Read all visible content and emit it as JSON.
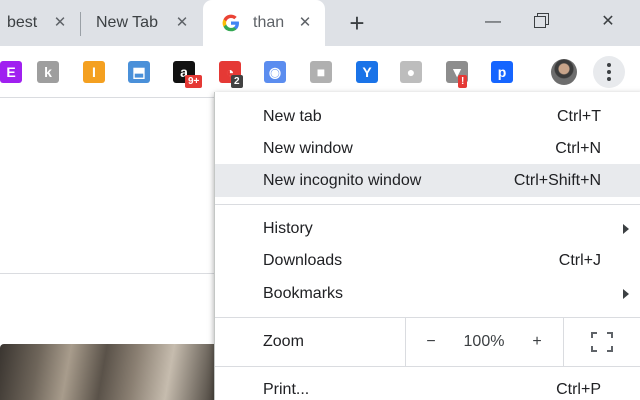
{
  "tabs": [
    {
      "title": "best",
      "close": "✕"
    },
    {
      "title": "New Tab",
      "close": "✕"
    },
    {
      "title": "than",
      "close": "✕"
    }
  ],
  "new_tab_symbol": "+",
  "window_controls": {
    "minimize": "—",
    "close": "✕"
  },
  "extensions": [
    {
      "icon": "purple-e-extension-icon",
      "glyph": "E",
      "color": "#a020f0"
    },
    {
      "icon": "grey-k-extension-icon",
      "glyph": "k",
      "color": "#9e9e9e"
    },
    {
      "icon": "orange-bar-extension-icon",
      "glyph": "I",
      "color": "#f4a020"
    },
    {
      "icon": "image-extension-icon",
      "glyph": "⬒",
      "color": "#4a90d9"
    },
    {
      "icon": "amazon-extension-icon",
      "glyph": "a",
      "color": "#111111",
      "badge": "9+"
    },
    {
      "icon": "red-circle-extension-icon",
      "glyph": "◔",
      "color": "#e53935",
      "badge": "2"
    },
    {
      "icon": "camera-extension-icon",
      "glyph": "◉",
      "color": "#5b8def"
    },
    {
      "icon": "grey-box-extension-icon",
      "glyph": "■",
      "color": "#b0b0b0"
    },
    {
      "icon": "blue-y-extension-icon",
      "glyph": "Y",
      "color": "#1a73e8"
    },
    {
      "icon": "grey-orb-extension-icon",
      "glyph": "●",
      "color": "#bdbdbd"
    },
    {
      "icon": "grey-shield-extension-icon",
      "glyph": "▼",
      "color": "#8d8d8d",
      "badge": "!"
    },
    {
      "icon": "blue-p-extension-icon",
      "glyph": "p",
      "color": "#1565ff"
    }
  ],
  "menu": {
    "items": [
      {
        "label": "New tab",
        "shortcut": "Ctrl+T"
      },
      {
        "label": "New window",
        "shortcut": "Ctrl+N"
      },
      {
        "label": "New incognito window",
        "shortcut": "Ctrl+Shift+N"
      },
      {
        "label": "History",
        "shortcut": ""
      },
      {
        "label": "Downloads",
        "shortcut": "Ctrl+J"
      },
      {
        "label": "Bookmarks",
        "shortcut": ""
      }
    ],
    "zoom": {
      "label": "Zoom",
      "minus": "−",
      "value": "100%",
      "plus": "+"
    },
    "print": {
      "label": "Print...",
      "shortcut": "Ctrl+P"
    }
  }
}
